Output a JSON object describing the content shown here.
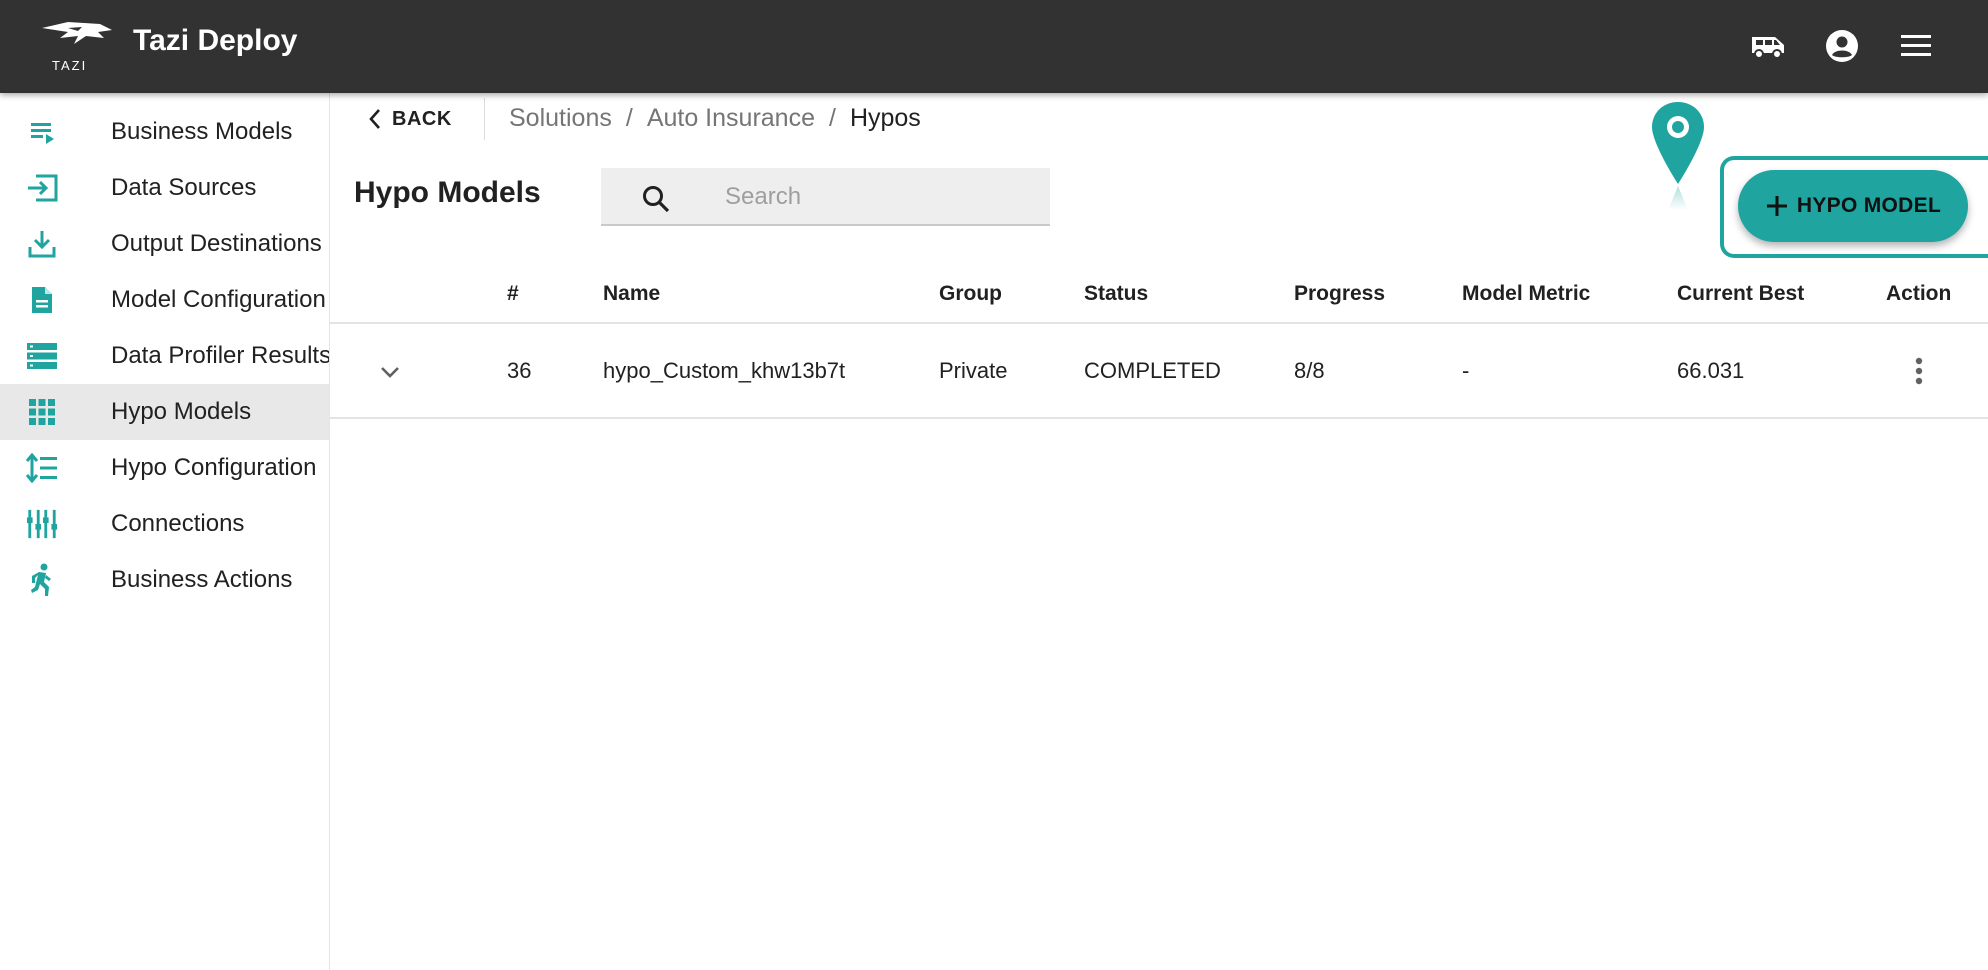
{
  "app": {
    "logo_text": "TAZI",
    "title": "Tazi Deploy",
    "icons": [
      "van-icon",
      "account-circle-icon",
      "hamburger-menu-icon"
    ]
  },
  "sidebar": {
    "items": [
      {
        "label": "Business Models",
        "icon": "list-play-icon",
        "active": false
      },
      {
        "label": "Data Sources",
        "icon": "login-arrow-icon",
        "active": false
      },
      {
        "label": "Output Destinations",
        "icon": "download-tray-icon",
        "active": false
      },
      {
        "label": "Model Configuration",
        "icon": "document-icon",
        "active": false
      },
      {
        "label": "Data Profiler Results",
        "icon": "storage-stack-icon",
        "active": false
      },
      {
        "label": "Hypo Models",
        "icon": "grid-dots-icon",
        "active": true
      },
      {
        "label": "Hypo Configuration",
        "icon": "format-line-spacing-icon",
        "active": false
      },
      {
        "label": "Connections",
        "icon": "tune-sliders-icon",
        "active": false
      },
      {
        "label": "Business Actions",
        "icon": "running-person-icon",
        "active": false
      }
    ]
  },
  "breadcrumb": {
    "back_label": "BACK",
    "items": [
      "Solutions",
      "Auto Insurance",
      "Hypos"
    ],
    "separator": "/"
  },
  "main": {
    "heading": "Hypo Models",
    "search_placeholder": "Search",
    "add_button_label": "HYPO MODEL"
  },
  "table": {
    "columns": [
      "#",
      "Name",
      "Group",
      "Status",
      "Progress",
      "Model Metric",
      "Current Best",
      "Action"
    ],
    "rows": [
      {
        "id": "36",
        "name": "hypo_Custom_khw13b7t",
        "group": "Private",
        "status": "COMPLETED",
        "progress": "8/8",
        "model_metric": "-",
        "current_best": "66.031"
      }
    ]
  },
  "colors": {
    "appbar": "#333233",
    "accent": "#1fa4a0",
    "active_nav": "#e8e8e8"
  }
}
